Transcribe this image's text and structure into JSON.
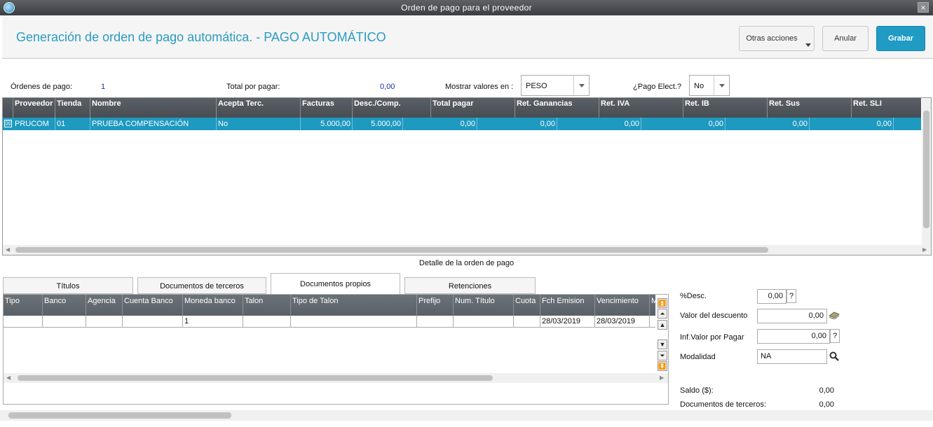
{
  "window": {
    "title": "Orden de pago para el proveedor",
    "close": "×"
  },
  "header": {
    "title": "Generación de orden de pago automática. - PAGO AUTOMÁTICO",
    "buttons": {
      "otras_acciones": "Otras acciones",
      "anular": "Anular",
      "grabar": "Grabar"
    }
  },
  "info": {
    "ordenes_label": "Órdenes de pago:",
    "ordenes_value": "1",
    "total_label": "Total por pagar:",
    "total_value": "0,00",
    "mostrar_label": "Mostrar valores en :",
    "mostrar_value": "PESO",
    "pago_label": "¿Pago Elect.?",
    "pago_value": "No"
  },
  "grid": {
    "columns": [
      "Proveedor",
      "Tienda",
      "Nombre",
      "Acepta Terc.",
      "Facturas",
      "Desc./Comp.",
      "Total pagar",
      "Ret. Ganancias",
      "Ret. IVA",
      "Ret. IB",
      "Ret. Sus",
      "Ret. SLI"
    ],
    "row": {
      "checked": "☒",
      "cells": [
        "PRUCOM",
        "01",
        "PRUEBA COMPENSACIÓN",
        "No",
        "5.000,00",
        "5.000,00",
        "0,00",
        "0,00",
        "0,00",
        "0,00",
        "0,00",
        "0,00"
      ]
    }
  },
  "detail": {
    "title": "Detalle de la orden de pago",
    "tabs": [
      "Títulos",
      "Documentos de terceros",
      "Documentos propios",
      "Retenciones"
    ],
    "columns": [
      "Tipo",
      "Banco",
      "Agencia",
      "Cuenta Banco",
      "Moneda banco",
      "Talon",
      "Tipo de Talon",
      "Prefijo",
      "Num. Título",
      "Cuota",
      "Fch Emision",
      "Vencimiento",
      "M"
    ],
    "row": [
      "",
      "",
      "",
      "",
      "1",
      "",
      "",
      "",
      "",
      "",
      "28/03/2019",
      "28/03/2019",
      ""
    ]
  },
  "right_panel": {
    "desc_pct_label": "%Desc.",
    "desc_pct_value": "0,00",
    "valor_desc_label": "Valor del descuento",
    "valor_desc_value": "0,00",
    "inf_valor_label": "Inf.Valor por Pagar",
    "inf_valor_value": "0,00",
    "modalidad_label": "Modalidad",
    "modalidad_value": "NA",
    "saldo_label": "Saldo ($):",
    "saldo_value": "0,00",
    "doc_terceros_label": "Documentos de terceros:",
    "doc_terceros_value": "0,00",
    "help": "?"
  }
}
